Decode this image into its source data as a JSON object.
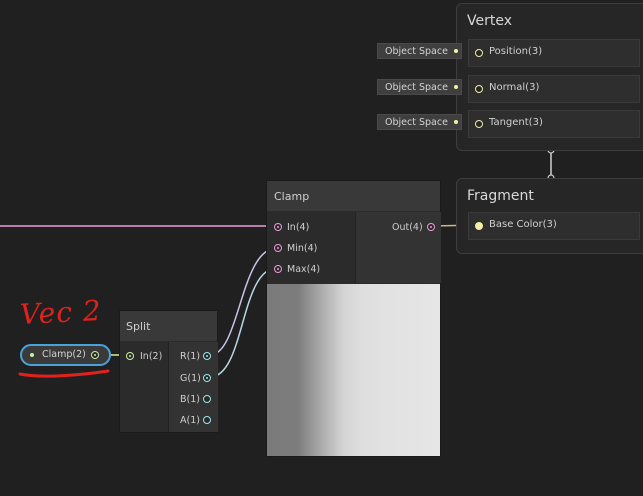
{
  "vertex": {
    "title": "Vertex",
    "slots": [
      {
        "label": "Position(3)",
        "space": "Object Space"
      },
      {
        "label": "Normal(3)",
        "space": "Object Space"
      },
      {
        "label": "Tangent(3)",
        "space": "Object Space"
      }
    ]
  },
  "fragment": {
    "title": "Fragment",
    "slots": [
      {
        "label": "Base Color(3)"
      }
    ]
  },
  "clamp_node": {
    "title": "Clamp",
    "inputs": [
      "In(4)",
      "Min(4)",
      "Max(4)"
    ],
    "output": "Out(4)"
  },
  "split_node": {
    "title": "Split",
    "input": "In(2)",
    "outputs": [
      "R(1)",
      "G(1)",
      "B(1)",
      "A(1)"
    ]
  },
  "property_node": {
    "label": "Clamp(2)"
  },
  "annotation": {
    "text": "Vec 2",
    "color": "#e0221e"
  },
  "colors": {
    "background": "#202020",
    "wire_yellow": "#f1f0a4",
    "wire_pink": "#ee9ad8",
    "wire_cyan": "#9ce8e8",
    "wire_green": "#c7f0a0",
    "selection": "#4aa3d8"
  }
}
